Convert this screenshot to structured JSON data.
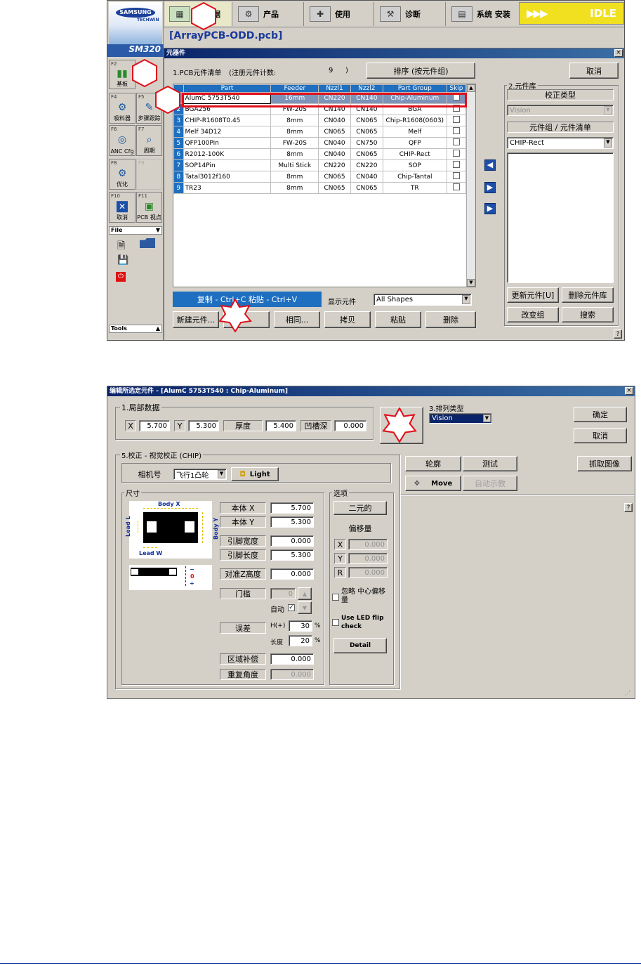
{
  "top_app": {
    "logo_brand": "SAMSUNG",
    "logo_sub": "TECHWIN",
    "model": "SM320",
    "toolbar": [
      {
        "label": "",
        "icon": "pcb-edit-icon"
      },
      {
        "label": "产品",
        "icon": "product-icon"
      },
      {
        "label": "使用",
        "icon": "use-icon"
      },
      {
        "label": "诊断",
        "icon": "diagnose-icon"
      },
      {
        "label": "系统 安装",
        "icon": "system-setup-icon"
      }
    ],
    "toolbar_partial": "据",
    "status": "IDLE",
    "status_arrows": "▶▶▶",
    "filename": "[ArrayPCB-ODD.pcb]",
    "fkeys": [
      {
        "key": "F2",
        "label": "基板"
      },
      {
        "key": "F4",
        "label": "吸料器"
      },
      {
        "key": "F5",
        "label": "步骤跟踪"
      },
      {
        "key": "F6",
        "label": "ANC Cfg"
      },
      {
        "key": "F7",
        "label": "周期"
      },
      {
        "key": "F8",
        "label": "优化"
      },
      {
        "key": "F9",
        "label": ""
      },
      {
        "key": "F10",
        "label": "取消"
      },
      {
        "key": "F11",
        "label": "PCB 视点"
      }
    ],
    "file_label": "File",
    "tools_label": "Tools",
    "dialog": {
      "title": "元器件",
      "list_title": "1.PCB元件清单",
      "count_label": "(注册元件计数:",
      "count": "9",
      "count_close": ")",
      "sort_button": "排序 (按元件组)",
      "cancel": "取消",
      "columns": [
        "",
        "Part",
        "Feeder",
        "Nzzl1",
        "Nzzl2",
        "Part Group",
        "Skip"
      ],
      "rows": [
        [
          "1",
          "AlumC 5753T540",
          "16mm",
          "CN220",
          "CN140",
          "Chip-Aluminum"
        ],
        [
          "2",
          "BGA256",
          "FW-20S",
          "CN140",
          "CN140",
          "BGA"
        ],
        [
          "3",
          "CHIP-R1608T0.45",
          "8mm",
          "CN040",
          "CN065",
          "Chip-R1608(0603)"
        ],
        [
          "4",
          "Melf 34D12",
          "8mm",
          "CN065",
          "CN065",
          "Melf"
        ],
        [
          "5",
          "QFP100Pin",
          "FW-20S",
          "CN040",
          "CN750",
          "QFP"
        ],
        [
          "6",
          "R2012-100K",
          "8mm",
          "CN040",
          "CN065",
          "CHIP-Rect"
        ],
        [
          "7",
          "SOP14Pin",
          "Multi Stick",
          "CN220",
          "CN220",
          "SOP"
        ],
        [
          "8",
          "Tatal3012f160",
          "8mm",
          "CN065",
          "CN040",
          "Chip-Tantal"
        ],
        [
          "9",
          "TR23",
          "8mm",
          "CN065",
          "CN065",
          "TR"
        ]
      ],
      "hint": "复制 - Ctrl+C  粘贴 - Ctrl+V",
      "show_label": "显示元件",
      "show_value": "All Shapes",
      "buttons": [
        "新建元件...",
        "",
        "相同...",
        "拷贝",
        "粘贴",
        "删除"
      ],
      "lib_title": "2.元件库",
      "calib_type": "校正类型",
      "calib_value": "Vision",
      "group_list": "元件组 / 元件清单",
      "group_value": "CHIP-Rect",
      "lib_buttons": [
        "更新元件[U]",
        "删除元件库",
        "改变组",
        "搜索"
      ],
      "help": "?"
    },
    "markers": [
      "1",
      "2",
      "3",
      "4"
    ]
  },
  "edit_dialog": {
    "title": "编辑所选定元件 - [AlumC 5753T540 : Chip-Aluminum]",
    "local_title": "1.局部数据",
    "x_label": "X",
    "x": "5.700",
    "y_label": "Y",
    "y": "5.300",
    "thick_label": "厚度",
    "thick": "5.400",
    "groove_label": "凹槽深",
    "groove": "0.000",
    "arr_label": "3.排列类型",
    "arr_value": "Vision",
    "ok": "确定",
    "cancel": "取消",
    "calib_title": "5.校正 - 视觉校正 (CHIP)",
    "cam_label": "相机号",
    "cam_value": "飞行1凸轮",
    "light": "Light",
    "btn_outline": "轮廓",
    "btn_test": "测试",
    "btn_move": "Move",
    "btn_auto": "自动示教",
    "btn_grab": "抓取图像",
    "size_title": "尺寸",
    "lead_l": "Lead L",
    "lead_w": "Lead W",
    "body_x": "Body X",
    "body_y": "Body Y",
    "fields": [
      {
        "label": "本体 X",
        "value": "5.700"
      },
      {
        "label": "本体 Y",
        "value": "5.300"
      },
      {
        "label": "引脚宽度",
        "value": "0.000"
      },
      {
        "label": "引脚长度",
        "value": "5.300"
      },
      {
        "label": "对准Z高度",
        "value": "0.000"
      }
    ],
    "threshold_label": "门槛",
    "threshold": "0",
    "auto_label": "自动",
    "err_label": "误差",
    "h_label": "H(+)",
    "h_value": "30",
    "len_label": "长度",
    "len_value": "20",
    "pct": "%",
    "area_label": "区域补偿",
    "area_value": "0.000",
    "repeat_label": "重复角度",
    "repeat_value": "0.000",
    "opt_title": "选项",
    "binary": "二元的",
    "offset": "偏移量",
    "off_rows": [
      {
        "k": "X",
        "v": "0.000"
      },
      {
        "k": "Y",
        "v": "0.000"
      },
      {
        "k": "R",
        "v": "0.000"
      }
    ],
    "ignore": "忽略 中心偏移量",
    "use_led": "Use LED flip check",
    "detail": "Detail",
    "help": "?",
    "minus": "−",
    "zero": "0",
    "plus": "+"
  }
}
